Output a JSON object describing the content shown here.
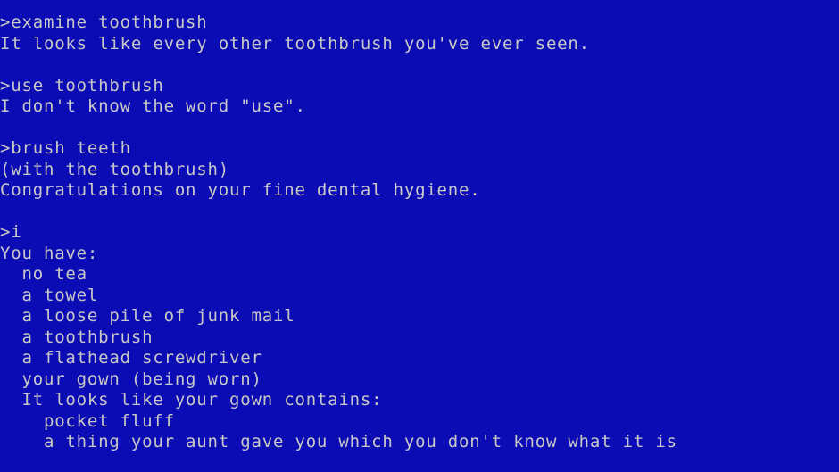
{
  "colors": {
    "background": "#0c0cb4",
    "text": "#c8c8c8"
  },
  "transcript": [
    {
      "kind": "command",
      "text": ">examine toothbrush"
    },
    {
      "kind": "output",
      "text": "It looks like every other toothbrush you've ever seen."
    },
    {
      "kind": "blank",
      "text": ""
    },
    {
      "kind": "command",
      "text": ">use toothbrush"
    },
    {
      "kind": "output",
      "text": "I don't know the word \"use\"."
    },
    {
      "kind": "blank",
      "text": ""
    },
    {
      "kind": "command",
      "text": ">brush teeth"
    },
    {
      "kind": "output",
      "text": "(with the toothbrush)"
    },
    {
      "kind": "output",
      "text": "Congratulations on your fine dental hygiene."
    },
    {
      "kind": "blank",
      "text": ""
    },
    {
      "kind": "command",
      "text": ">i"
    },
    {
      "kind": "output",
      "text": "You have:"
    },
    {
      "kind": "output",
      "text": "  no tea"
    },
    {
      "kind": "output",
      "text": "  a towel"
    },
    {
      "kind": "output",
      "text": "  a loose pile of junk mail"
    },
    {
      "kind": "output",
      "text": "  a toothbrush"
    },
    {
      "kind": "output",
      "text": "  a flathead screwdriver"
    },
    {
      "kind": "output",
      "text": "  your gown (being worn)"
    },
    {
      "kind": "output",
      "text": "  It looks like your gown contains:"
    },
    {
      "kind": "output",
      "text": "    pocket fluff"
    },
    {
      "kind": "output",
      "text": "    a thing your aunt gave you which you don't know what it is"
    }
  ]
}
